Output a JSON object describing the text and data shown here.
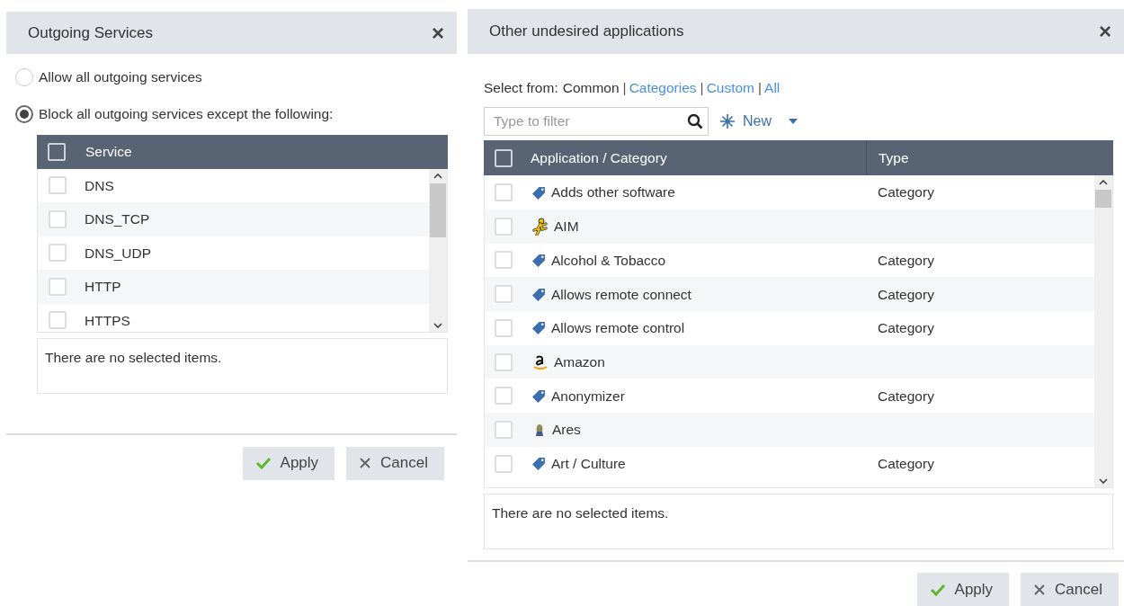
{
  "left_dialog": {
    "title": "Outgoing Services",
    "close": "×",
    "options": [
      {
        "label": "Allow all outgoing services",
        "selected": false
      },
      {
        "label": "Block all outgoing services except the following:",
        "selected": true
      }
    ],
    "table": {
      "columns": [
        "Service"
      ],
      "all_checked": false,
      "rows": [
        {
          "name": "DNS",
          "checked": false
        },
        {
          "name": "DNS_TCP",
          "checked": false
        },
        {
          "name": "DNS_UDP",
          "checked": false
        },
        {
          "name": "HTTP",
          "checked": false
        },
        {
          "name": "HTTPS",
          "checked": false
        }
      ]
    },
    "selection_note": "There are no selected items.",
    "buttons": [
      {
        "kind": "apply",
        "label": "Apply"
      },
      {
        "kind": "cancel",
        "label": "Cancel"
      }
    ]
  },
  "right_dialog": {
    "title": "Other undesired applications",
    "close": "×",
    "select_from": {
      "label": "Select from:",
      "options": [
        {
          "label": "Common",
          "selected": true
        },
        {
          "prefix": "|",
          "label": "Categories",
          "selected": false
        },
        {
          "prefix": "|",
          "label": "Custom",
          "selected": false
        },
        {
          "prefix": "|",
          "label": "All",
          "selected": false
        }
      ]
    },
    "filter": {
      "placeholder": "Type to filter"
    },
    "new_button": "New",
    "table": {
      "columns": [
        "Application / Category",
        "Type"
      ],
      "all_checked": false,
      "rows": [
        {
          "kind": "category",
          "name": "Adds other software",
          "type": "Category",
          "checked": false
        },
        {
          "kind": "aim",
          "name": "AIM",
          "checked": false
        },
        {
          "kind": "category",
          "name": "Alcohol & Tobacco",
          "type": "Category",
          "checked": false
        },
        {
          "kind": "category",
          "name": "Allows remote connect",
          "type": "Category",
          "checked": false
        },
        {
          "kind": "category",
          "name": "Allows remote control",
          "type": "Category",
          "checked": false
        },
        {
          "kind": "amazon",
          "name": "Amazon",
          "checked": false
        },
        {
          "kind": "category",
          "name": "Anonymizer",
          "type": "Category",
          "checked": false
        },
        {
          "kind": "ares",
          "name": "Ares",
          "checked": false
        },
        {
          "kind": "category",
          "name": "Art / Culture",
          "type": "Category",
          "checked": false
        }
      ]
    },
    "selection_note": "There are no selected items.",
    "buttons": [
      {
        "kind": "apply",
        "label": "Apply"
      },
      {
        "kind": "cancel",
        "label": "Cancel"
      }
    ]
  }
}
